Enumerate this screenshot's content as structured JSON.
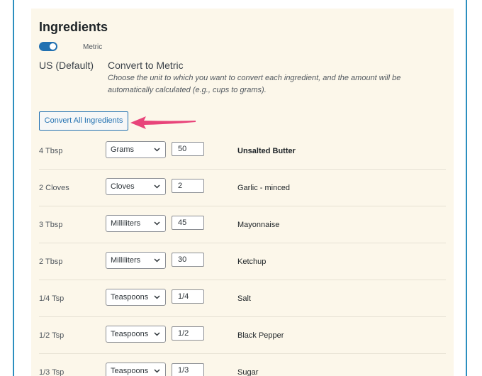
{
  "header": {
    "title": "Ingredients"
  },
  "toggle": {
    "label": "Metric",
    "on": true
  },
  "options": {
    "us_label": "US (Default)",
    "convert_title": "Convert to Metric",
    "convert_desc": "Choose the unit to which you want to convert each ingredient, and the amount will be automatically calculated (e.g., cups to grams)."
  },
  "convert_button": {
    "label": "Convert All Ingredients"
  },
  "colors": {
    "accent": "#2271b1",
    "arrow": "#e8447a",
    "panel": "#fcf7ea"
  },
  "ingredients": [
    {
      "amount": "4 Tbsp",
      "unit": "Grams",
      "qty": "50",
      "name": "Unsalted Butter"
    },
    {
      "amount": "2 Cloves",
      "unit": "Cloves",
      "qty": "2",
      "name": "Garlic - minced"
    },
    {
      "amount": "3 Tbsp",
      "unit": "Milliliters",
      "qty": "45",
      "name": "Mayonnaise"
    },
    {
      "amount": "2 Tbsp",
      "unit": "Milliliters",
      "qty": "30",
      "name": "Ketchup"
    },
    {
      "amount": "1/4 Tsp",
      "unit": "Teaspoons",
      "qty": "1/4",
      "name": "Salt"
    },
    {
      "amount": "1/2 Tsp",
      "unit": "Teaspoons",
      "qty": "1/2",
      "name": "Black Pepper"
    },
    {
      "amount": "1/3 Tsp",
      "unit": "Teaspoons",
      "qty": "1/3",
      "name": "Sugar"
    }
  ]
}
